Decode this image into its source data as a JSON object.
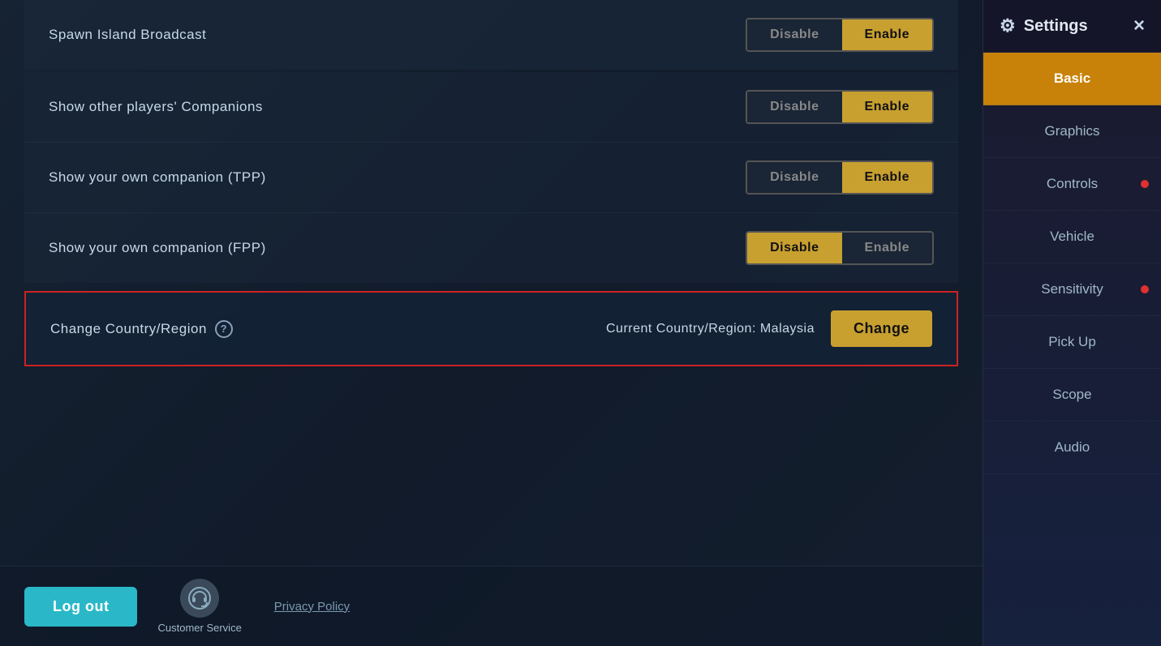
{
  "header": {
    "title": "Settings",
    "close_label": "×"
  },
  "sidebar": {
    "nav_items": [
      {
        "id": "basic",
        "label": "Basic",
        "active": true,
        "notification": false
      },
      {
        "id": "graphics",
        "label": "Graphics",
        "active": false,
        "notification": false
      },
      {
        "id": "controls",
        "label": "Controls",
        "active": false,
        "notification": true
      },
      {
        "id": "vehicle",
        "label": "Vehicle",
        "active": false,
        "notification": false
      },
      {
        "id": "sensitivity",
        "label": "Sensitivity",
        "active": false,
        "notification": true
      },
      {
        "id": "pickup",
        "label": "Pick Up",
        "active": false,
        "notification": false
      },
      {
        "id": "scope",
        "label": "Scope",
        "active": false,
        "notification": false
      },
      {
        "id": "audio",
        "label": "Audio",
        "active": false,
        "notification": false
      }
    ]
  },
  "settings": {
    "spawn_island_broadcast": {
      "label": "Spawn Island Broadcast",
      "disable_label": "Disable",
      "enable_label": "Enable",
      "selected": "enable"
    },
    "show_companions": {
      "label": "Show other players' Companions",
      "disable_label": "Disable",
      "enable_label": "Enable",
      "selected": "enable"
    },
    "show_own_companion_tpp": {
      "label": "Show your own companion (TPP)",
      "disable_label": "Disable",
      "enable_label": "Enable",
      "selected": "enable"
    },
    "show_own_companion_fpp": {
      "label": "Show your own companion (FPP)",
      "disable_label": "Disable",
      "enable_label": "Enable",
      "selected": "disable"
    },
    "change_region": {
      "label": "Change Country/Region",
      "current_region_prefix": "Current Country/Region: ",
      "current_region_value": "Malaysia",
      "change_button_label": "Change",
      "highlighted": true
    }
  },
  "footer": {
    "logout_label": "Log out",
    "customer_service_label": "Customer Service",
    "privacy_policy_label": "Privacy Policy"
  },
  "icons": {
    "gear": "⚙",
    "close": "✕",
    "headset": "🎧",
    "help": "?"
  }
}
